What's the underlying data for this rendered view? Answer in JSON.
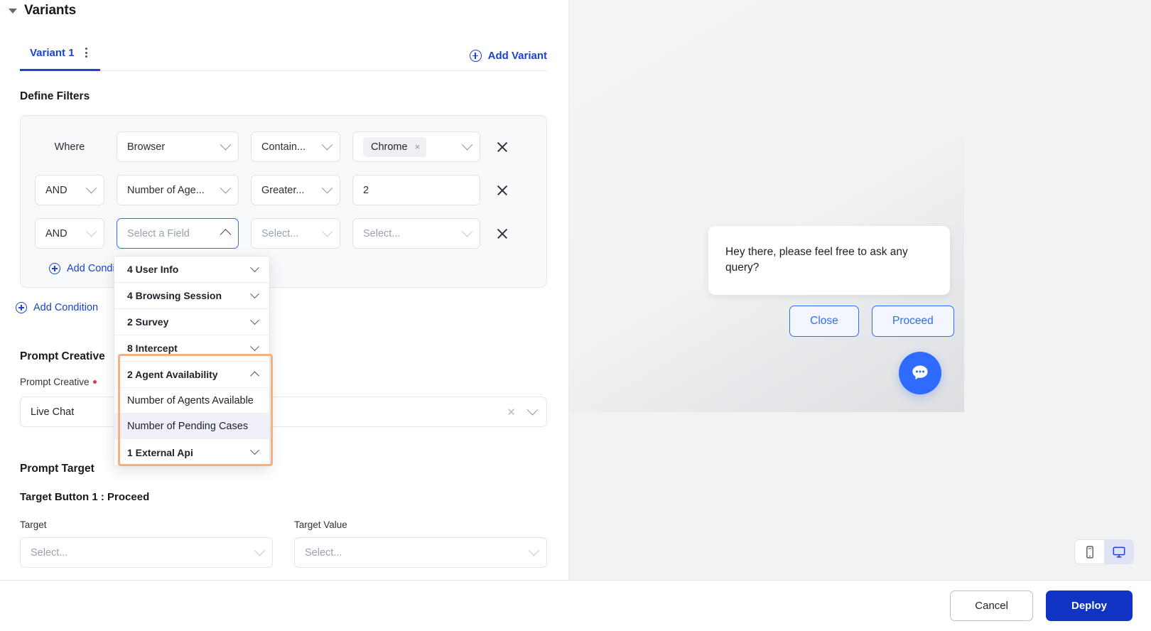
{
  "section": {
    "title": "Variants",
    "caret": "caret-down-icon"
  },
  "tabs": {
    "active_label": "Variant 1",
    "kebab": "more-options-icon",
    "add_variant_label": "Add Variant",
    "add_variant_icon": "circle-plus-icon"
  },
  "filters": {
    "title": "Define Filters",
    "rows": [
      {
        "conj": "Where",
        "conj_is_select": false,
        "field": "Browser",
        "field_placeholder": "",
        "operator": "Contain...",
        "value_type": "chip",
        "value_chip": "Chrome",
        "chip_remove": "×",
        "value": ""
      },
      {
        "conj": "AND",
        "conj_is_select": true,
        "field": "Number of Age...",
        "field_placeholder": "",
        "operator": "Greater...",
        "value_type": "text",
        "value": "2"
      },
      {
        "conj": "AND",
        "conj_is_select": true,
        "field": "",
        "field_placeholder": "Select a Field",
        "operator": "",
        "operator_placeholder": "Select...",
        "value_type": "select",
        "value": "",
        "value_placeholder": "Select..."
      }
    ],
    "add_condition_inner": "Add Condition",
    "add_condition_outer": "Add Condition",
    "remove_row_icon": "close-icon"
  },
  "field_dropdown": {
    "items": [
      {
        "label": "4 User Info",
        "type": "group",
        "expanded": false
      },
      {
        "label": "4 Browsing Session",
        "type": "group",
        "expanded": false
      },
      {
        "label": "2 Survey",
        "type": "group",
        "expanded": false
      },
      {
        "label": "8 Intercept",
        "type": "group",
        "expanded": false
      },
      {
        "label": "2 Agent Availability",
        "type": "group",
        "expanded": true
      },
      {
        "label": "Number of Agents Available",
        "type": "leaf",
        "highlighted": false
      },
      {
        "label": "Number of Pending Cases",
        "type": "leaf",
        "highlighted": true
      },
      {
        "label": "1 External Api",
        "type": "group",
        "expanded": false
      }
    ],
    "highlight_color": "#f2b183"
  },
  "prompt_creative": {
    "heading": "Prompt Creative",
    "field_label": "Prompt Creative",
    "required_marker": "•",
    "value": "Live Chat",
    "clear_icon": "close-icon",
    "chevron_icon": "chevron-down-icon"
  },
  "prompt_target": {
    "heading": "Prompt Target",
    "subheading": "Target Button 1 : Proceed",
    "target_label": "Target",
    "target_placeholder": "Select...",
    "target_value_label": "Target Value",
    "target_value_placeholder": "Select..."
  },
  "preview": {
    "message": "Hey there, please feel free to ask any query?",
    "close_label": "Close",
    "proceed_label": "Proceed",
    "launcher_icon": "chat-bubble-icon",
    "device_mobile_icon": "mobile-icon",
    "device_desktop_icon": "desktop-icon",
    "active_device": "desktop"
  },
  "footer": {
    "cancel_label": "Cancel",
    "deploy_label": "Deploy"
  },
  "colors": {
    "accent_blue": "#1a43d0",
    "primary_button": "#1133c4",
    "preview_blue": "#2f6bff",
    "highlight_orange": "#f2b183",
    "required_red": "#e0363c"
  }
}
